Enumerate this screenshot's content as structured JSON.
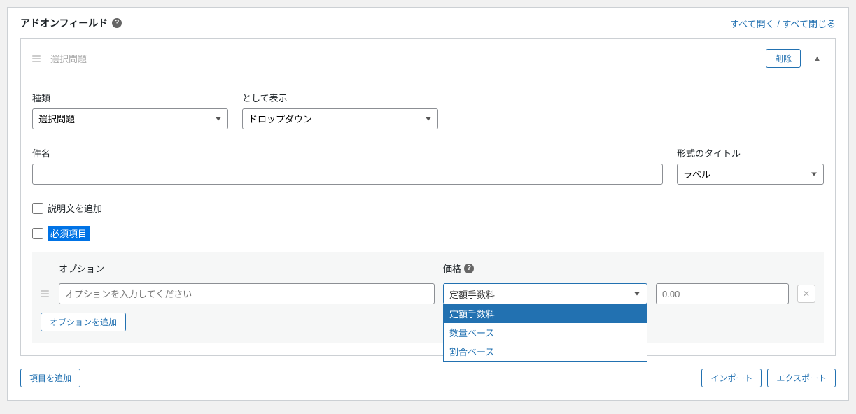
{
  "panel": {
    "title": "アドオンフィールド",
    "expand_all": "すべて開く",
    "collapse_all": "すべて閉じる",
    "separator": " / "
  },
  "field": {
    "header_title": "選択問題",
    "delete_label": "削除",
    "type_label": "種類",
    "type_value": "選択問題",
    "display_as_label": "として表示",
    "display_as_value": "ドロップダウン",
    "subject_label": "件名",
    "subject_value": "",
    "title_format_label": "形式のタイトル",
    "title_format_value": "ラベル",
    "add_description_label": "説明文を追加",
    "required_label": "必須項目"
  },
  "options": {
    "option_header": "オプション",
    "price_header": "価格",
    "row": {
      "name_placeholder": "オプションを入力してください",
      "name_value": "",
      "price_type_value": "定額手数料",
      "price_value": "",
      "price_placeholder": "0.00"
    },
    "dropdown_items": [
      "定額手数料",
      "数量ベース",
      "割合ベース"
    ],
    "add_option_label": "オプションを追加"
  },
  "footer": {
    "add_item_label": "項目を追加",
    "import_label": "インポート",
    "export_label": "エクスポート"
  }
}
